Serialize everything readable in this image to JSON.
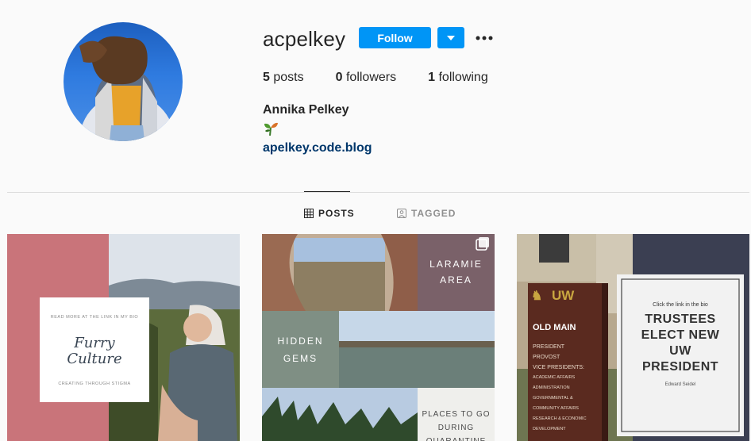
{
  "profile": {
    "username": "acpelkey",
    "follow_label": "Follow",
    "stats": {
      "posts_count": "5",
      "posts_label": "posts",
      "followers_count": "0",
      "followers_label": "followers",
      "following_count": "1",
      "following_label": "following"
    },
    "full_name": "Annika Pelkey",
    "bio_emoji": "plant-sprout-icon",
    "website": "apelkey.code.blog"
  },
  "tabs": [
    {
      "label": "POSTS",
      "icon": "grid-icon",
      "active": true
    },
    {
      "label": "TAGGED",
      "icon": "tag-icon",
      "active": false
    }
  ],
  "posts": [
    {
      "card_top": "READ MORE AT THE LINK IN MY BIO",
      "card_title_1": "Furry",
      "card_title_2": "Culture",
      "card_bottom": "CREATING THROUGH STIGMA"
    },
    {
      "label_1a": "LARAMIE",
      "label_1b": "AREA",
      "label_2a": "HIDDEN",
      "label_2b": "GEMS",
      "label_3a": "PLACES TO GO",
      "label_3b": "DURING",
      "label_3c": "QUARANTINE",
      "multi_icon": "carousel-icon"
    },
    {
      "sign_logo": "UW",
      "sign_title": "OLD MAIN",
      "sign_lines": [
        "PRESIDENT",
        "PROVOST",
        "VICE PRESIDENTS:",
        "ACADEMIC AFFAIRS",
        "ADMINISTRATION",
        "GOVERNMENTAL &",
        "COMMUNITY AFFAIRS",
        "RESEARCH & ECONOMIC",
        "DEVELOPMENT"
      ],
      "card_top": "Click the link in the bio",
      "card_line_1": "TRUSTEES",
      "card_line_2": "ELECT NEW",
      "card_line_3": "UW",
      "card_line_4": "PRESIDENT",
      "card_byline": "Edward Seidel"
    }
  ],
  "colors": {
    "accent": "#0095f6",
    "link": "#00376b",
    "post1_band": "#c9747a",
    "post2_tile": "#7a6169",
    "post3_panel": "#3b3f52"
  }
}
